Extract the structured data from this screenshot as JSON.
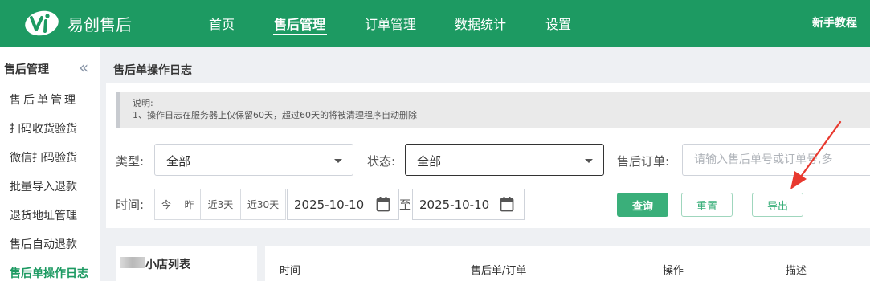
{
  "header": {
    "brand": "易创售后",
    "nav": [
      "首页",
      "售后管理",
      "订单管理",
      "数据统计",
      "设置"
    ],
    "active_nav": "售后管理",
    "tutorial": "新手教程",
    "accent_color": "#1d9a62"
  },
  "sidebar": {
    "title": "售后管理",
    "collapse_icon": "double-chevron-left-icon",
    "items": [
      {
        "label": "售后单管理"
      },
      {
        "label": "扫码收货验货"
      },
      {
        "label": "微信扫码验货"
      },
      {
        "label": "批量导入退款"
      },
      {
        "label": "退货地址管理"
      },
      {
        "label": "售后自动退款"
      },
      {
        "label": "售后单操作日志"
      }
    ],
    "active_item": "售后单操作日志"
  },
  "page": {
    "title": "售后单操作日志",
    "notice": {
      "heading": "说明:",
      "line1": "1、操作日志在服务器上仅保留60天，超过60天的将被清理程序自动删除"
    }
  },
  "filters": {
    "type_label": "类型:",
    "type_value": "全部",
    "status_label": "状态:",
    "status_value": "全部",
    "order_label": "售后订单:",
    "order_placeholder": "请输入售后单号或订单号,多",
    "time_label": "时间:",
    "quick_ranges": [
      "今",
      "昨",
      "近3天",
      "近30天"
    ],
    "date_from": "2025-10-10",
    "to_label": "至",
    "date_to": "2025-10-10",
    "query_button": "查询",
    "reset_button": "重置",
    "export_button": "导出"
  },
  "shop_list": {
    "title": "小店列表"
  },
  "table": {
    "columns": [
      "时间",
      "售后单/订单",
      "操作",
      "描述"
    ]
  }
}
